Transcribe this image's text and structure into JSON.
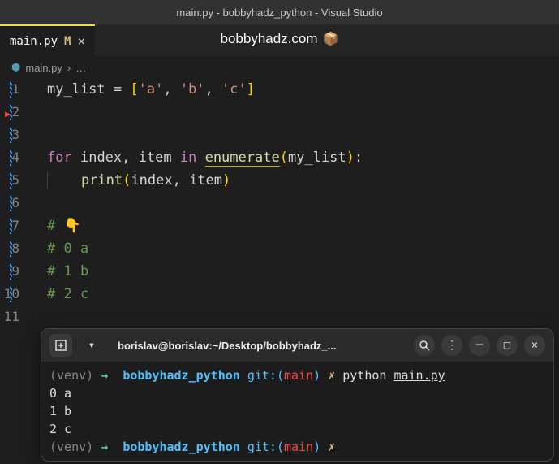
{
  "title_bar": "main.py - bobbyhadz_python - Visual Studio",
  "tab": {
    "label": "main.py",
    "modified": "M"
  },
  "watermark": {
    "text": "bobbyhadz.com",
    "icon": "📦"
  },
  "breadcrumb": {
    "file": "main.py",
    "sep": "›",
    "more": "…"
  },
  "code": {
    "l1": {
      "var": "my_list",
      "eq": " = ",
      "b1": "[",
      "s1": "'a'",
      "c1": ", ",
      "s2": "'b'",
      "c2": ", ",
      "s3": "'c'",
      "b2": "]"
    },
    "l4": {
      "kw1": "for",
      "sp1": " ",
      "v1": "index",
      "c": ", ",
      "v2": "item",
      "sp2": " ",
      "kw2": "in",
      "sp3": " ",
      "fn": "enumerate",
      "p1": "(",
      "arg": "my_list",
      "p2": ")",
      "col": ":"
    },
    "l5": {
      "indent": "    ",
      "fn": "print",
      "p1": "(",
      "a1": "index",
      "c": ", ",
      "a2": "item",
      "p2": ")"
    },
    "l7": "# 👇",
    "l8": "# 0 a",
    "l9": "# 1 b",
    "l10": "# 2 c"
  },
  "line_numbers": [
    "1",
    "2",
    "3",
    "4",
    "5",
    "6",
    "7",
    "8",
    "9",
    "10",
    "11"
  ],
  "terminal": {
    "path": "borislav@borislav:~/Desktop/bobbyhadz_...",
    "prompt": {
      "venv": "(venv)",
      "arrow": "→",
      "proj": "bobbyhadz_python",
      "git": "git:(",
      "branch": "main",
      "git2": ")",
      "x": "✗"
    },
    "cmd1": {
      "cmd": "python ",
      "file": "main.py"
    },
    "out": [
      "0 a",
      "1 b",
      "2 c"
    ]
  }
}
